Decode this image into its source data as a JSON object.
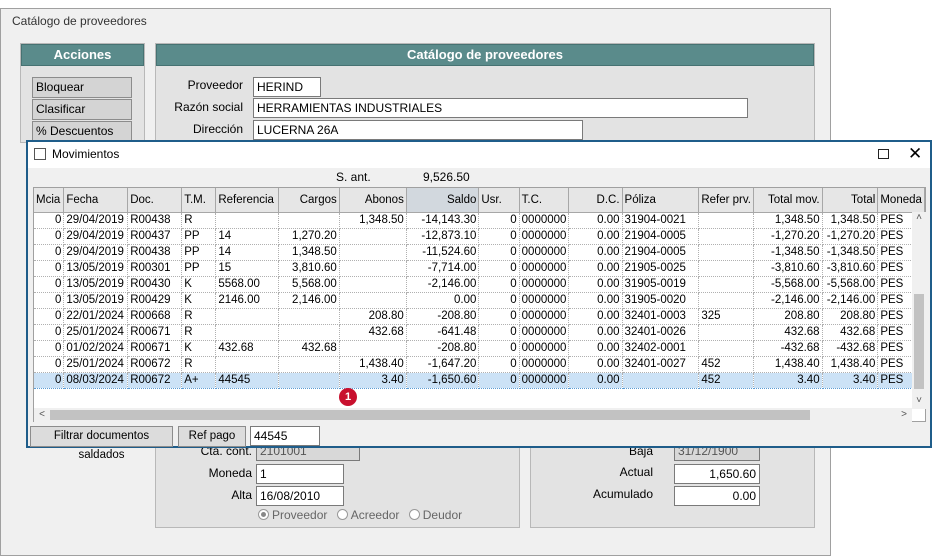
{
  "back_window": {
    "title": "Catálogo de proveedores",
    "actions_header": "Acciones",
    "actions": [
      "Bloquear",
      "Clasificar",
      "% Descuentos"
    ],
    "main_header": "Catálogo de proveedores",
    "proveedor_label": "Proveedor",
    "proveedor_value": "HERIND",
    "razon_label": "Razón social",
    "razon_value": "HERRAMIENTAS INDUSTRIALES",
    "direccion_label": "Dirección",
    "direccion_value": "LUCERNA 26A",
    "cta_label": "Cta. cont.",
    "cta_value": "2101001",
    "moneda_label": "Moneda",
    "moneda_value": "1",
    "alta_label": "Alta",
    "alta_value": "16/08/2010",
    "radio_options": [
      "Proveedor",
      "Acreedor",
      "Deudor"
    ],
    "baja_label": "Baja",
    "baja_value": "31/12/1900",
    "actual_label": "Actual",
    "actual_value": "1,650.60",
    "acumulado_label": "Acumulado",
    "acumulado_value": "0.00"
  },
  "movimientos": {
    "title": "Movimientos",
    "sant_label": "S. ant.",
    "sant_value": "9,526.50",
    "columns": [
      "Mcia",
      "Fecha",
      "Doc.",
      "T.M.",
      "Referencia",
      "Cargos",
      "Abonos",
      "Saldo",
      "Usr.",
      "T.C.",
      "D.C.",
      "Póliza",
      "Refer prv.",
      "Total mov.",
      "Total",
      "Moneda"
    ],
    "rows": [
      [
        "0",
        "29/04/2019",
        "R00438",
        "R",
        "",
        "",
        "1,348.50",
        "-14,143.30",
        "0",
        "0000000",
        "0.00",
        "31904-0021",
        "",
        "1,348.50",
        "1,348.50",
        "PES"
      ],
      [
        "0",
        "29/04/2019",
        "R00437",
        "PP",
        "14",
        "1,270.20",
        "",
        "-12,873.10",
        "0",
        "0000000",
        "0.00",
        "21904-0005",
        "",
        "-1,270.20",
        "-1,270.20",
        "PES"
      ],
      [
        "0",
        "29/04/2019",
        "R00438",
        "PP",
        "14",
        "1,348.50",
        "",
        "-11,524.60",
        "0",
        "0000000",
        "0.00",
        "21904-0005",
        "",
        "-1,348.50",
        "-1,348.50",
        "PES"
      ],
      [
        "0",
        "13/05/2019",
        "R00301",
        "PP",
        "15",
        "3,810.60",
        "",
        "-7,714.00",
        "0",
        "0000000",
        "0.00",
        "21905-0025",
        "",
        "-3,810.60",
        "-3,810.60",
        "PES"
      ],
      [
        "0",
        "13/05/2019",
        "R00430",
        "K",
        "5568.00",
        "5,568.00",
        "",
        "-2,146.00",
        "0",
        "0000000",
        "0.00",
        "31905-0019",
        "",
        "-5,568.00",
        "-5,568.00",
        "PES"
      ],
      [
        "0",
        "13/05/2019",
        "R00429",
        "K",
        "2146.00",
        "2,146.00",
        "",
        "0.00",
        "0",
        "0000000",
        "0.00",
        "31905-0020",
        "",
        "-2,146.00",
        "-2,146.00",
        "PES"
      ],
      [
        "0",
        "22/01/2024",
        "R00668",
        "R",
        "",
        "",
        "208.80",
        "-208.80",
        "0",
        "0000000",
        "0.00",
        "32401-0003",
        "325",
        "208.80",
        "208.80",
        "PES"
      ],
      [
        "0",
        "25/01/2024",
        "R00671",
        "R",
        "",
        "",
        "432.68",
        "-641.48",
        "0",
        "0000000",
        "0.00",
        "32401-0026",
        "",
        "432.68",
        "432.68",
        "PES"
      ],
      [
        "0",
        "01/02/2024",
        "R00671",
        "K",
        "432.68",
        "432.68",
        "",
        "-208.80",
        "0",
        "0000000",
        "0.00",
        "32402-0001",
        "",
        "-432.68",
        "-432.68",
        "PES"
      ],
      [
        "0",
        "25/01/2024",
        "R00672",
        "R",
        "",
        "",
        "1,438.40",
        "-1,647.20",
        "0",
        "0000000",
        "0.00",
        "32401-0027",
        "452",
        "1,438.40",
        "1,438.40",
        "PES"
      ],
      [
        "0",
        "08/03/2024",
        "R00672",
        "A+",
        "44545",
        "",
        "3.40",
        "-1,650.60",
        "0",
        "0000000",
        "0.00",
        "",
        "452",
        "3.40",
        "3.40",
        "PES"
      ]
    ],
    "badge": "1",
    "filter_button": "Filtrar  documentos saldados",
    "refpago_button": "Ref pago",
    "refpago_value": "44545"
  }
}
